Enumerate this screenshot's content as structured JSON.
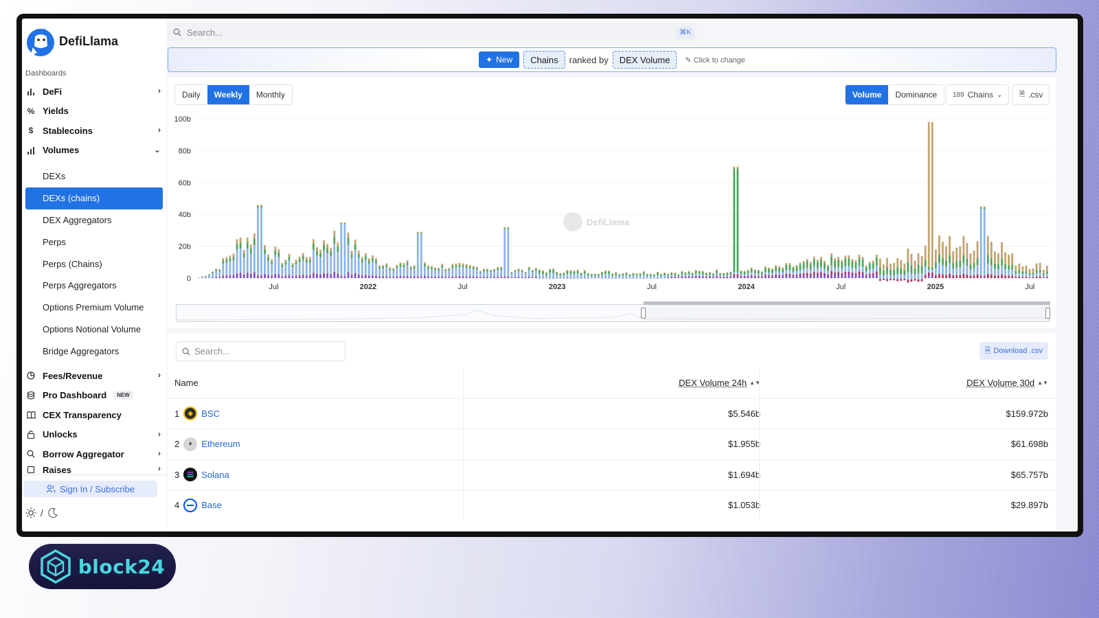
{
  "brand": {
    "name": "DefiLlama"
  },
  "sidebar": {
    "section_label": "Dashboards",
    "items_top": [
      {
        "label": "DeFi",
        "icon": "bar-chart-icon",
        "chevron": true
      },
      {
        "label": "Yields",
        "icon": "percent-icon",
        "chevron": false
      },
      {
        "label": "Stablecoins",
        "icon": "dollar-icon",
        "chevron": true
      },
      {
        "label": "Volumes",
        "icon": "bar-chart-icon",
        "chevron": "down"
      }
    ],
    "volumes_sub": [
      "DEXs",
      "DEXs (chains)",
      "DEX Aggregators",
      "Perps",
      "Perps (Chains)",
      "Perps Aggregators",
      "Options Premium Volume",
      "Options Notional Volume",
      "Bridge Aggregators"
    ],
    "active_sub": "DEXs (chains)",
    "items_bottom": [
      {
        "label": "Fees/Revenue",
        "icon": "pie-icon",
        "chevron": true
      },
      {
        "label": "Pro Dashboard",
        "icon": "database-icon",
        "chevron": false,
        "tag": "NEW"
      },
      {
        "label": "CEX Transparency",
        "icon": "book-icon",
        "chevron": false
      },
      {
        "label": "Unlocks",
        "icon": "lock-icon",
        "chevron": true
      },
      {
        "label": "Borrow Aggregator",
        "icon": "search-icon",
        "chevron": true
      },
      {
        "label": "Raises",
        "icon": "square-icon",
        "chevron": true
      }
    ],
    "signin": "Sign In / Subscribe",
    "theme_separator": "/"
  },
  "topbar": {
    "search_placeholder": "Search...",
    "shortcut": "⌘K"
  },
  "banner": {
    "new_label": "New",
    "metric_a": "Chains",
    "joiner": "ranked by",
    "metric_b": "DEX Volume",
    "hint": "Click to change"
  },
  "controls": {
    "periods": [
      "Daily",
      "Weekly",
      "Monthly"
    ],
    "period_selected": "Weekly",
    "modes": [
      "Volume",
      "Dominance"
    ],
    "mode_selected": "Volume",
    "chains_count": "189",
    "chains_label": "Chains",
    "csv_label": ".csv"
  },
  "chart_data": {
    "type": "bar",
    "stacked": true,
    "ylim": [
      0,
      100
    ],
    "yticks": [
      "0",
      "20b",
      "40b",
      "60b",
      "80b",
      "100b"
    ],
    "xticks": [
      "Jul",
      "2022",
      "Jul",
      "2023",
      "Jul",
      "2024",
      "Jul",
      "2025",
      "Jul"
    ],
    "watermark": "DefiLlama",
    "colors": {
      "bsc": "#c4a26e",
      "ethereum": "#8db3e6",
      "solana": "#4fa35a",
      "base": "#b0325a",
      "other": "#7f4ec7"
    },
    "peaks": [
      {
        "x": 0.07,
        "y": 46
      },
      {
        "x": 0.17,
        "y": 35
      },
      {
        "x": 0.26,
        "y": 29
      },
      {
        "x": 0.36,
        "y": 32
      },
      {
        "x": 0.63,
        "y": 70
      },
      {
        "x": 0.86,
        "y": 98
      },
      {
        "x": 0.92,
        "y": 45
      }
    ]
  },
  "table": {
    "search_placeholder": "Search...",
    "download_label": "Download .csv",
    "headers": {
      "name": "Name",
      "v24": "DEX Volume 24h",
      "v30": "DEX Volume 30d"
    },
    "rows": [
      {
        "rank": "1",
        "name": "BSC",
        "v24": "$5.546b",
        "v30": "$159.972b",
        "icon": "bsc-icon"
      },
      {
        "rank": "2",
        "name": "Ethereum",
        "v24": "$1.955b",
        "v30": "$61.698b",
        "icon": "ethereum-icon"
      },
      {
        "rank": "3",
        "name": "Solana",
        "v24": "$1.694b",
        "v30": "$65.757b",
        "icon": "solana-icon"
      },
      {
        "rank": "4",
        "name": "Base",
        "v24": "$1.053b",
        "v30": "$29.897b",
        "icon": "base-icon"
      }
    ]
  },
  "footer_brand": {
    "name": "block24"
  }
}
